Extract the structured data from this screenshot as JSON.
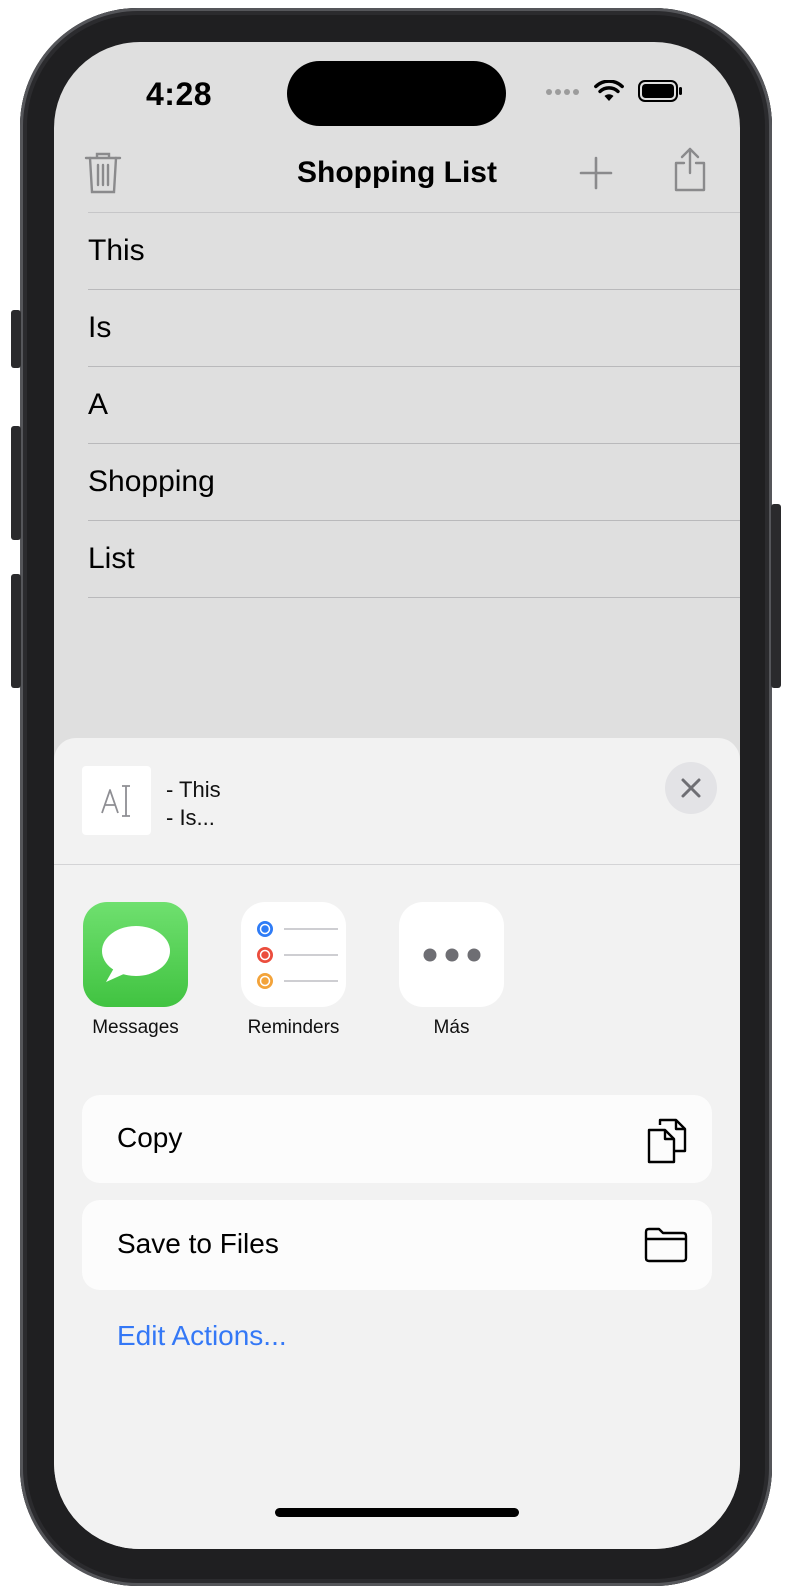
{
  "status_bar": {
    "time": "4:28"
  },
  "nav": {
    "title": "Shopping List"
  },
  "list": {
    "items": [
      "This",
      "Is",
      "A",
      "Shopping",
      "List"
    ]
  },
  "share_sheet": {
    "preview_line_1": "- This",
    "preview_line_2": "- Is...",
    "apps": [
      {
        "label": "Messages",
        "icon": "messages-icon"
      },
      {
        "label": "Reminders",
        "icon": "reminders-icon"
      },
      {
        "label": "Más",
        "icon": "more-icon"
      }
    ],
    "actions": [
      {
        "label": "Copy",
        "icon": "copy-icon"
      },
      {
        "label": "Save to Files",
        "icon": "folder-icon"
      }
    ],
    "edit_actions_label": "Edit Actions..."
  },
  "colors": {
    "link": "#3478f6",
    "messages_green": "#5fd15f",
    "reminder_blue": "#2f7cf6",
    "reminder_red": "#eb4d3d",
    "reminder_orange": "#f3a33a"
  }
}
